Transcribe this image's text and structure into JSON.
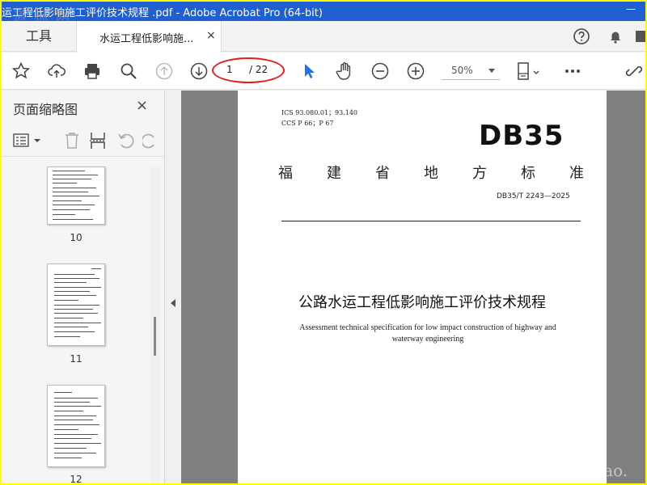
{
  "window": {
    "title": "运工程低影响施工评价技术规程 .pdf - Adobe Acrobat Pro (64-bit)",
    "watermark": "道 标 网"
  },
  "tabs": {
    "tools_label": "工具",
    "document_label": "水运工程低影响施...",
    "close_glyph": "×"
  },
  "toolbar": {
    "page_current": "1",
    "page_total": "/ 22",
    "zoom": "50%"
  },
  "thumbnail_panel": {
    "title": "页面缩略图",
    "close_glyph": "×",
    "thumbnails": [
      {
        "page": "10"
      },
      {
        "page": "11"
      },
      {
        "page": "12"
      }
    ]
  },
  "document": {
    "ics": "ICS  93.080.01；93.140",
    "ccs": "CCS  P 66；P 67",
    "code": "DB35",
    "province_chars": [
      "福",
      "建",
      "省",
      "地",
      "方",
      "标",
      "准"
    ],
    "standard_no": "DB35/T  2243—2025",
    "title_cn": "公路水运工程低影响施工评价技术规程",
    "title_en": "Assessment technical specification for low impact construction of highway and waterway engineering"
  },
  "site_watermark": "www.cndao."
}
